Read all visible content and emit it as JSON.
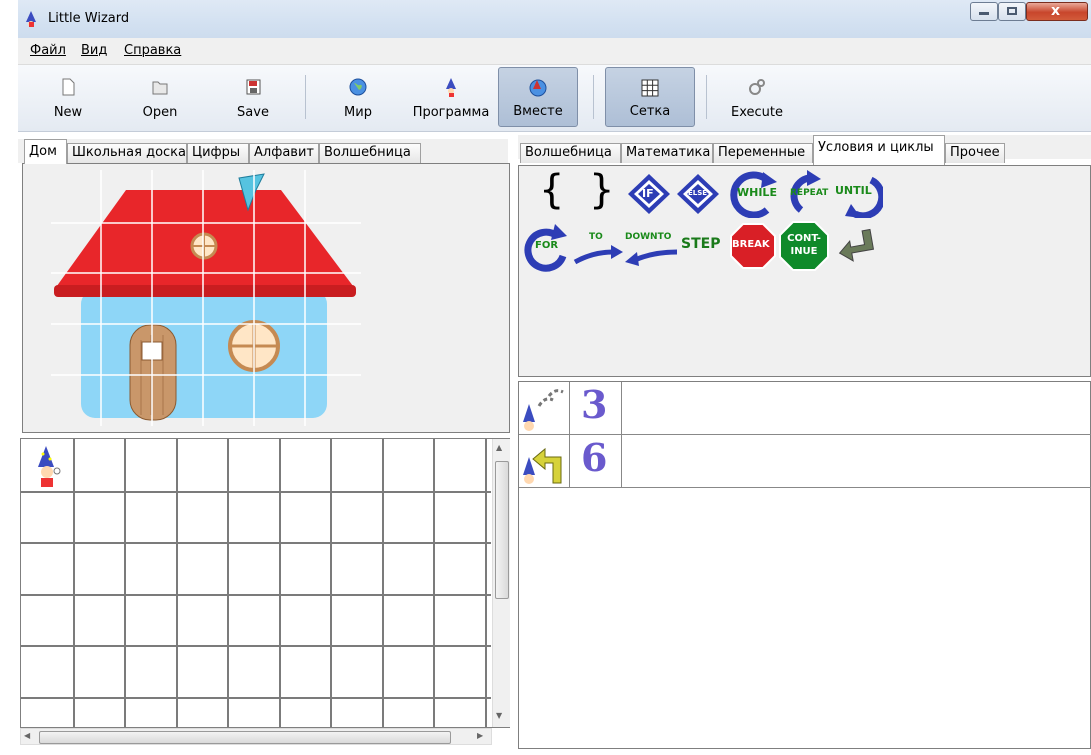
{
  "window": {
    "title": "Little Wizard"
  },
  "menu": {
    "file": "Файл",
    "view": "Вид",
    "help": "Справка"
  },
  "toolbar": {
    "new": "New",
    "open": "Open",
    "save": "Save",
    "world": "Мир",
    "program": "Программа",
    "together": "Вместе",
    "grid": "Сетка",
    "execute": "Execute"
  },
  "left_tabs": [
    "Дом",
    "Школьная доска",
    "Цифры",
    "Алфавит",
    "Волшебница"
  ],
  "right_tabs": [
    "Волшебница",
    "Математика",
    "Переменные",
    "Условия и циклы",
    "Прочее"
  ],
  "palette": {
    "open_brace": "{",
    "close_brace": "}",
    "if": "IF",
    "else": "ELSE",
    "while": "WHILE",
    "repeat": "REPEAT",
    "until": "UNTIL",
    "for": "FOR",
    "to": "TO",
    "downto": "DOWNTO",
    "step": "STEP",
    "break": "BREAK",
    "continue": "CONT-\nINUE"
  },
  "program": [
    {
      "value": "3"
    },
    {
      "value": "6"
    }
  ],
  "colors": {
    "roof": "#e8262a",
    "wall": "#8ed6f7",
    "door": "#c9976a",
    "accent_blue": "#2d3db5"
  }
}
